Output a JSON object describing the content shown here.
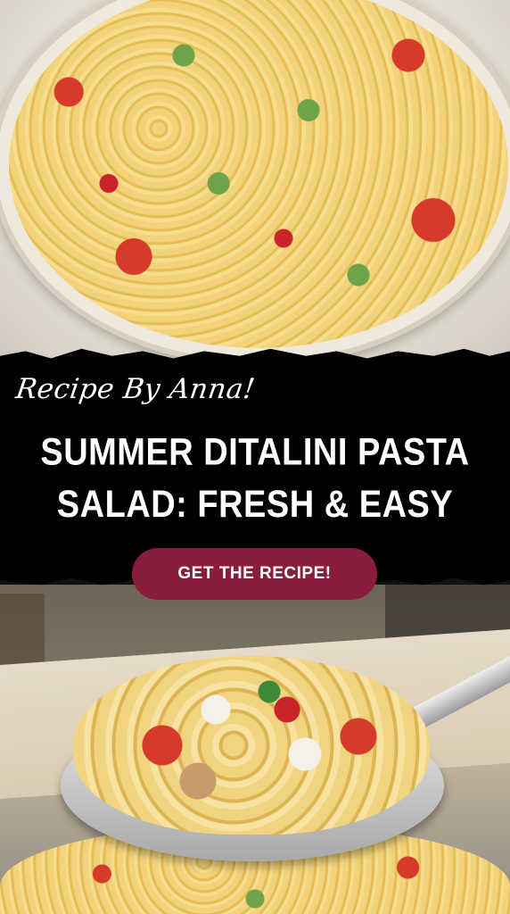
{
  "byline": "Recipe By Anna!",
  "title_lines": [
    "SUMMER DITALINI PASTA",
    "SALAD: FRESH & EASY"
  ],
  "cta_label": "GET THE RECIPE!",
  "colors": {
    "banner_bg": "#000000",
    "cta_bg": "#8a1c3e",
    "text": "#ffffff"
  }
}
